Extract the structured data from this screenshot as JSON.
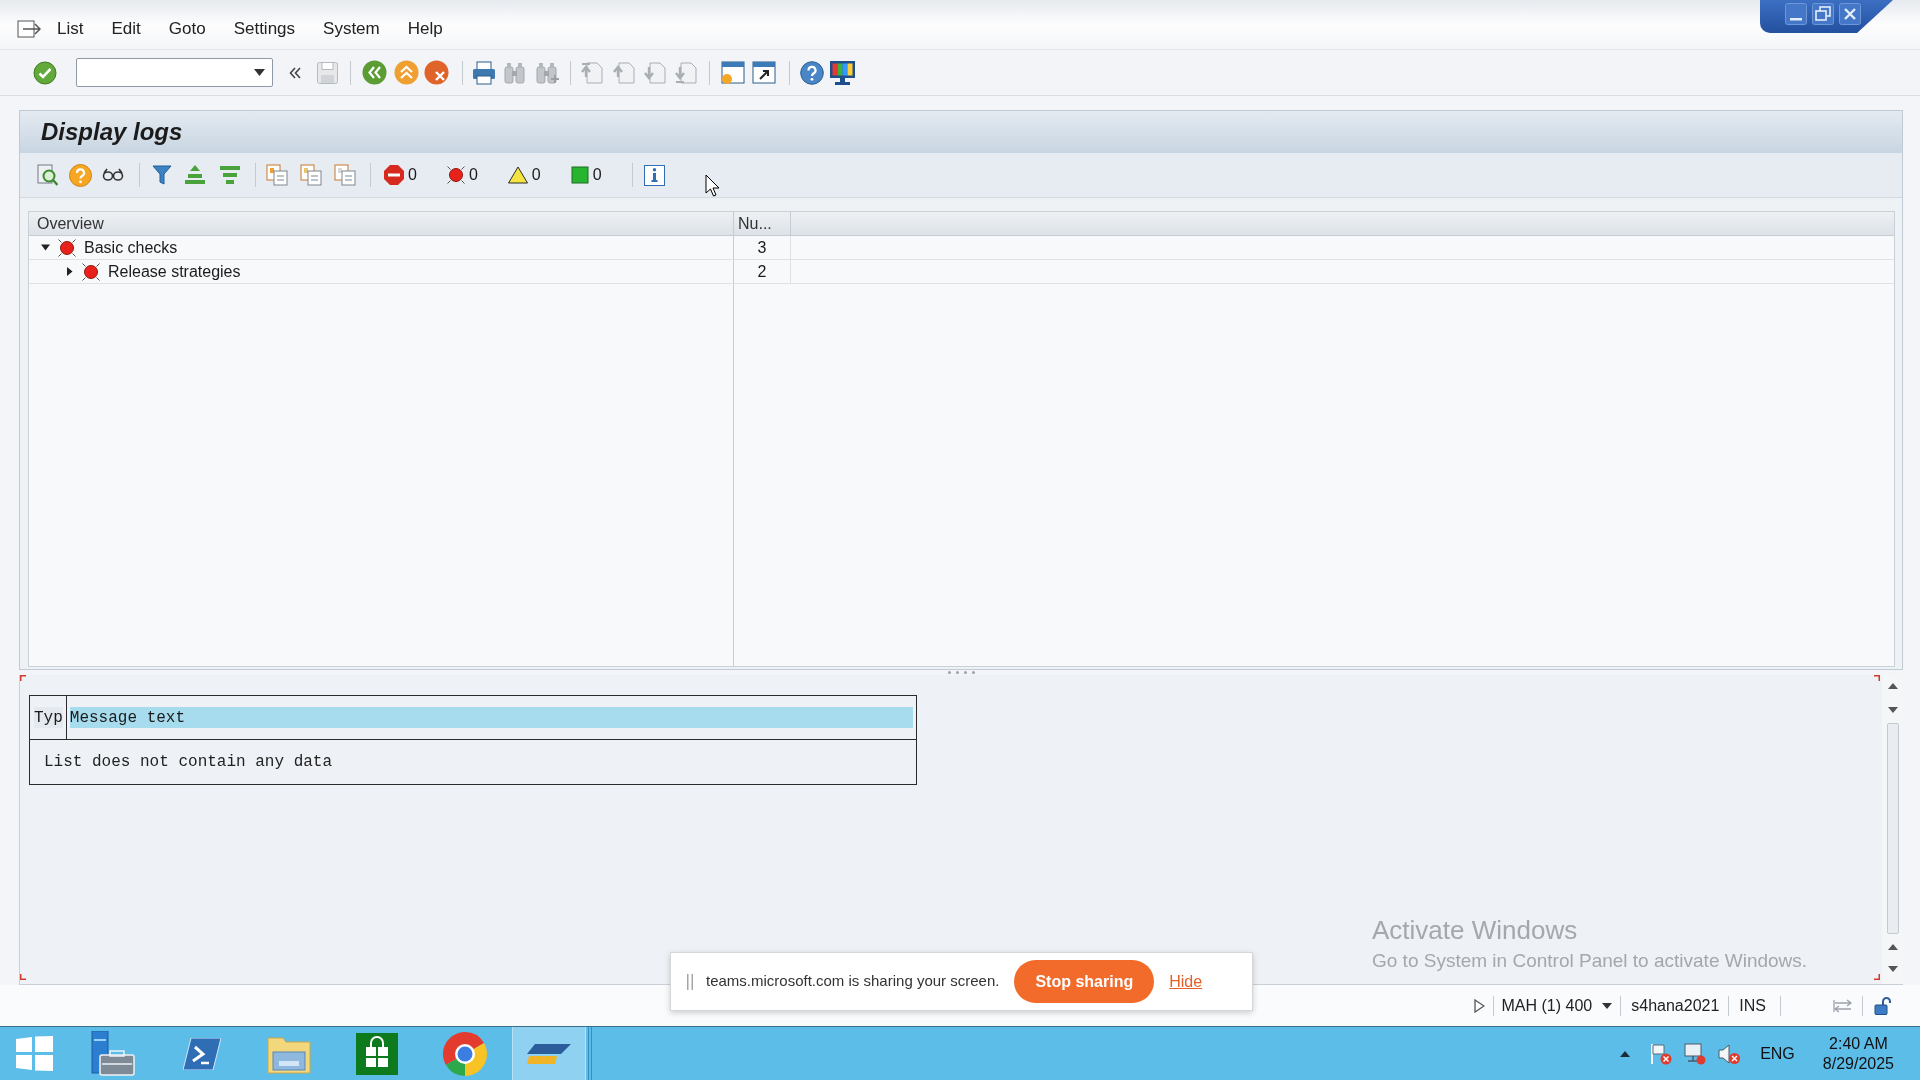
{
  "menu_bar": {
    "items": [
      "List",
      "Edit",
      "Goto",
      "Settings",
      "System",
      "Help"
    ]
  },
  "title": "Display logs",
  "message_counters": [
    {
      "kind": "stop",
      "count": "0"
    },
    {
      "kind": "error",
      "count": "0"
    },
    {
      "kind": "warning",
      "count": "0"
    },
    {
      "kind": "success",
      "count": "0"
    }
  ],
  "log_tree": {
    "columns": [
      "Overview",
      "Nu..."
    ],
    "rows": [
      {
        "label": "Basic checks",
        "count": "3",
        "kind": "error",
        "expanded": true,
        "children": [
          {
            "label": "Release strategies",
            "count": "2",
            "kind": "error",
            "expanded": false
          }
        ]
      }
    ]
  },
  "message_list": {
    "columns": [
      {
        "label": "Typ",
        "selected": false
      },
      {
        "label": "Message text",
        "selected": true
      }
    ],
    "empty_text": "List does not contain any data"
  },
  "activation_notice": {
    "title": "Activate Windows",
    "text": "Go to System in Control Panel to activate Windows."
  },
  "share_bar": {
    "text": "teams.microsoft.com is sharing your screen.",
    "stop_button": "Stop sharing",
    "hide_link": "Hide"
  },
  "status_bar": {
    "system": "MAH (1) 400",
    "server": "s4hana2021",
    "mode": "INS"
  },
  "taskbar": {
    "apps": [
      {
        "kind": "start",
        "selected": false
      },
      {
        "kind": "server",
        "selected": false
      },
      {
        "kind": "terminal",
        "selected": false
      },
      {
        "kind": "folder",
        "selected": false
      },
      {
        "kind": "store",
        "selected": false
      },
      {
        "kind": "browser",
        "selected": false
      },
      {
        "kind": "sap",
        "selected": true
      }
    ],
    "language": "ENG",
    "time": "2:40 AM",
    "date": "8/29/2025"
  }
}
